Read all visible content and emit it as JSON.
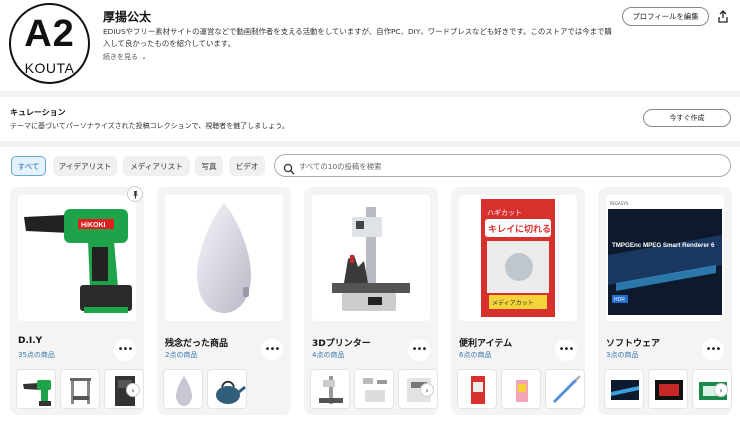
{
  "profile": {
    "avatar_main": "A2",
    "avatar_sub": "KOUTA",
    "name": "厚揚公太",
    "description": "EDIUSやフリー素材サイトの運営などで動画制作者を支える活動をしていますが、自作PC、DIY、ワードプレスなども好きです。このストアでは今まで購入して良かったものを紹介しています。",
    "see_more": "続きを見る",
    "edit_button": "プロフィールを編集"
  },
  "curation": {
    "title": "キュレーション",
    "description": "テーマに基づいてパーソナライズされた投稿コレクションで、視聴者を魅了しましょう。",
    "create_button": "今すぐ作成"
  },
  "filters": {
    "chips": [
      "すべて",
      "アイデアリスト",
      "メディアリスト",
      "写真",
      "ビデオ"
    ],
    "active": "すべて",
    "search_placeholder": "すべての10の投稿を検索"
  },
  "cards": [
    {
      "title": "D.I.Y",
      "count": "35点の商品"
    },
    {
      "title": "残念だった商品",
      "count": "2点の商品"
    },
    {
      "title": "3Dプリンター",
      "count": "4点の商品"
    },
    {
      "title": "便利アイテム",
      "count": "6点の商品"
    },
    {
      "title": "ソフトウェア",
      "count": "3点の商品"
    }
  ],
  "product_text": {
    "hikoki": "HiKOKI",
    "pack_line1": "ハギカット",
    "pack_line2": "キレイに切れる",
    "pack_line3": "メディアカット",
    "sw_title": "TMPGEnc MPEG Smart Renderer 6",
    "sw_brand": "PEGASYS",
    "sw_badge": "HDR"
  },
  "colors": {
    "accent": "#3b78b0",
    "chip_active_bg": "#e6f2fb",
    "hikoki_green": "#1fa34a"
  }
}
